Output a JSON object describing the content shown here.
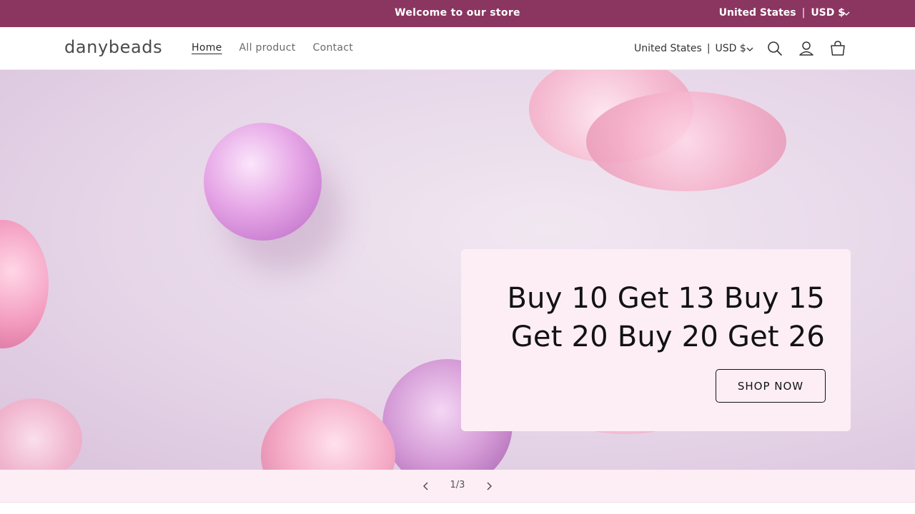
{
  "announcement": {
    "text": "Welcome to our store",
    "country": "United States",
    "separator": "|",
    "currency": "USD $"
  },
  "header": {
    "logo": "danybeads",
    "nav": [
      {
        "label": "Home",
        "active": true
      },
      {
        "label": "All product",
        "active": false
      },
      {
        "label": "Contact",
        "active": false
      }
    ],
    "country": "United States",
    "separator": "|",
    "currency": "USD $",
    "icons": [
      "search-icon",
      "account-icon",
      "cart-icon"
    ]
  },
  "hero": {
    "heading": "Buy 10 Get 13 Buy 15 Get 20 Buy 20 Get 26",
    "cta_label": "SHOP NOW"
  },
  "slider": {
    "counter": "1/3",
    "current": 1,
    "total": 3
  },
  "colors": {
    "announcement_bg": "#8b3561",
    "card_bg": "#fdeef6",
    "text": "#121212"
  }
}
